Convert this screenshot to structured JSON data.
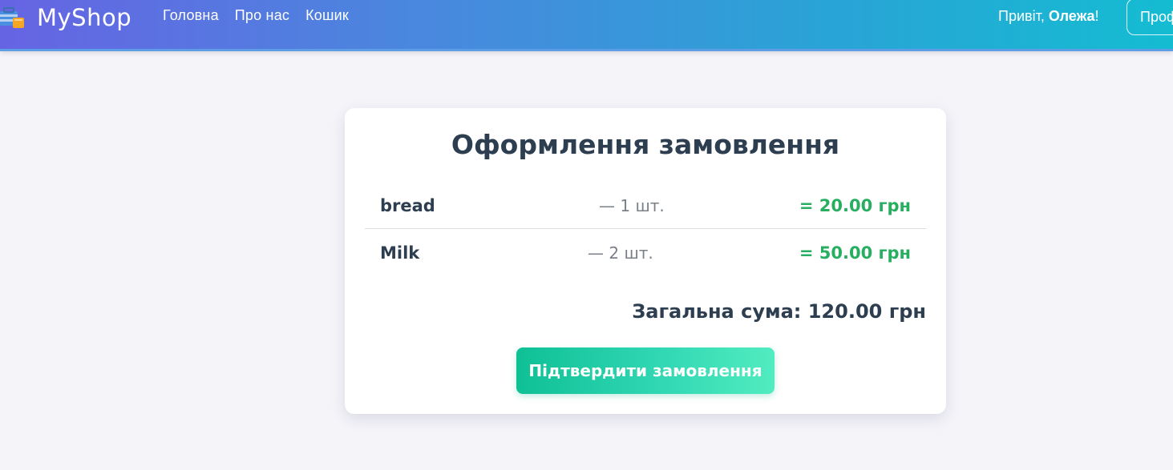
{
  "navbar": {
    "brand": "MyShop",
    "brand_icon": "shopping-bag-icon",
    "links": [
      "Головна",
      "Про нас",
      "Кошик"
    ],
    "greeting_prefix": "Привіт, ",
    "user_name": "Олежа",
    "greeting_suffix": "!",
    "profile_label": "Профіль"
  },
  "checkout": {
    "title": "Оформлення замовлення",
    "items": [
      {
        "name": "bread",
        "qty": "— 1 шт.",
        "price": "= 20.00 грн"
      },
      {
        "name": "Milk",
        "qty": "— 2 шт.",
        "price": "= 50.00 грн"
      }
    ],
    "total": "Загальна сума: 120.00 грн",
    "confirm_label": "Підтвердити замовлення"
  },
  "colors": {
    "accent_start": "#6664e3",
    "accent_end": "#14bcd2",
    "price_green": "#27ae60",
    "button_start": "#0fc095",
    "button_end": "#52ecc0",
    "text_dark": "#2c3e50"
  }
}
